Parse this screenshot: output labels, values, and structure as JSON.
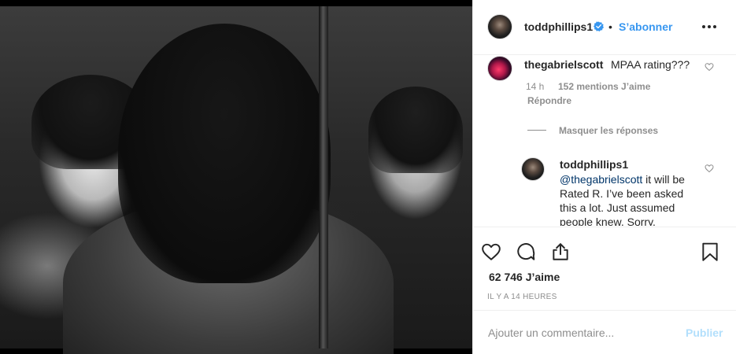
{
  "post": {
    "author": "toddphillips1",
    "follow_label": "S’abonner",
    "dot": "•",
    "likes_count": "62 746 J’aime",
    "time_ago": "IL Y A 14 HEURES"
  },
  "comments": [
    {
      "user": "thegabrielscott",
      "text": "MPAA rating???",
      "time": "14 h",
      "likes": "152 mentions J’aime",
      "reply_label": "Répondre",
      "hide_replies_label": "Masquer les réponses",
      "replies": [
        {
          "user": "toddphillips1",
          "mention": "@thegabrielscott",
          "text": " it will be Rated R. I’ve been asked this a lot. Just assumed people knew. Sorry."
        }
      ]
    }
  ],
  "composer": {
    "placeholder": "Ajouter un commentaire...",
    "publish_label": "Publier"
  },
  "colors": {
    "link": "#3897f0",
    "muted": "#8e8e8e",
    "text": "#262626",
    "publish_disabled": "#b2dffc",
    "mention": "#003569"
  }
}
